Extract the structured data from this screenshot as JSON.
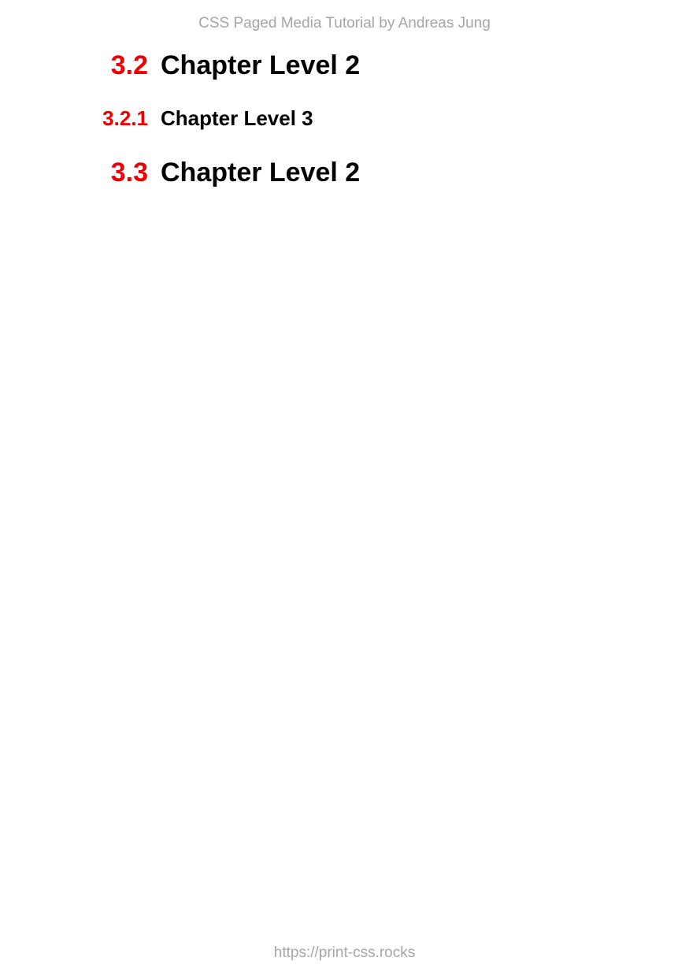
{
  "header": {
    "text": "CSS Paged Media Tutorial by Andreas Jung"
  },
  "headings": [
    {
      "number": "3.2",
      "title": "Chapter Level 2",
      "level": 2
    },
    {
      "number": "3.2.1",
      "title": "Chapter Level 3",
      "level": 3
    },
    {
      "number": "3.3",
      "title": "Chapter Level 2",
      "level": 2
    }
  ],
  "footer": {
    "text": "https://print-css.rocks"
  },
  "colors": {
    "number": "#ee0000",
    "title": "#000000",
    "header_footer": "#a6a6a6",
    "background": "#ffffff"
  }
}
